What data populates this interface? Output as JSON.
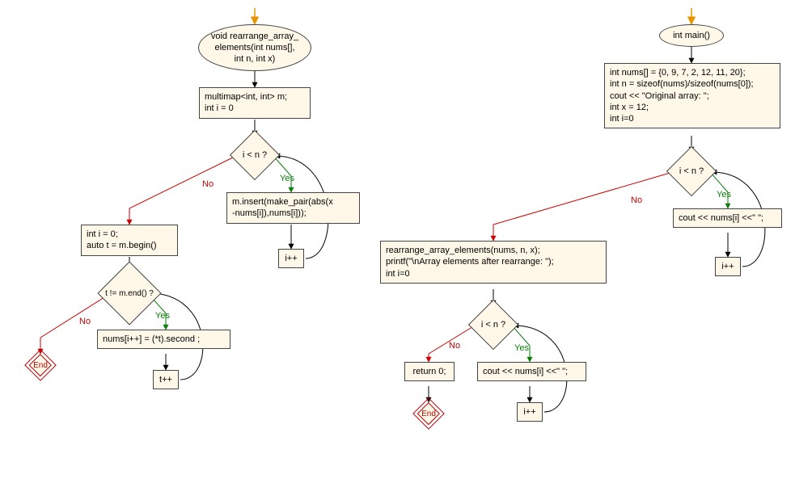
{
  "left": {
    "start": "void rearrange_array_\nelements(int nums[],\nint n, int x)",
    "decl": "multimap<int, int> m;\nint i = 0",
    "cond1": "i < n ?",
    "insert": "m.insert(make_pair(abs(x\n-nums[i]),nums[i]));",
    "inc1": "i++",
    "reset": "int i = 0;\nauto t = m.begin()",
    "cond2": "t != m.end() ?",
    "assign": "nums[i++] = (*t).second ;",
    "inc2": "t++",
    "end": "End"
  },
  "right": {
    "main": "int main()",
    "init": "int nums[] = {0, 9, 7, 2, 12, 11, 20};\nint n = sizeof(nums)/sizeof(nums[0]);\ncout << \"Original array: \";\nint x = 12;\nint i=0",
    "cond1": "i < n ?",
    "print1": "cout << nums[i] <<\" \";",
    "inc1": "i++",
    "call": "rearrange_array_elements(nums, n, x);\nprintf(\"\\nArray elements after rearrange: \");\nint i=0",
    "cond2": "i < n ?",
    "print2": "cout << nums[i] <<\" \";",
    "inc2": "i++",
    "ret": "return 0;",
    "end": "End"
  },
  "labels": {
    "yes": "Yes",
    "no": "No"
  }
}
